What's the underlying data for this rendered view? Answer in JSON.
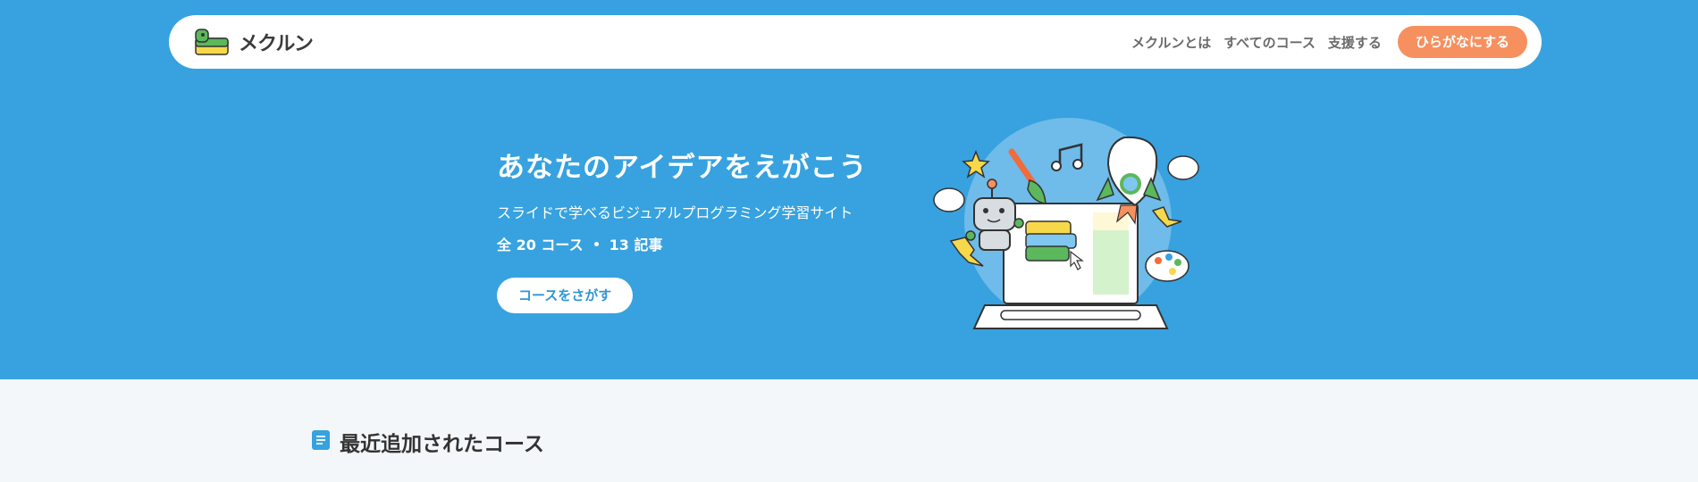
{
  "header": {
    "logo_text": "メクルン",
    "nav": [
      {
        "label": "メクルンとは"
      },
      {
        "label": "すべてのコース"
      },
      {
        "label": "支援する"
      }
    ],
    "cta_label": "ひらがなにする"
  },
  "hero": {
    "title": "あなたのアイデアをえがこう",
    "subtitle": "スライドで学べるビジュアルプログラミング学習サイト",
    "stats": {
      "courses": "全 20 コース",
      "articles": "13 記事"
    },
    "button_label": "コースをさがす"
  },
  "sections": {
    "recent_title": "最近追加されたコース"
  },
  "colors": {
    "hero_bg": "#37a2df",
    "cta_orange": "#f6905e",
    "page_bg": "#f4f7f9",
    "text_dark": "#333333"
  },
  "icons": [
    "logo-icon",
    "book-icon",
    "rocket-icon",
    "robot-icon",
    "music-note-icon",
    "star-icon",
    "palette-icon",
    "paintbrush-icon",
    "lightning-icon",
    "speech-bubble-icon",
    "cursor-icon",
    "laptop-icon"
  ]
}
